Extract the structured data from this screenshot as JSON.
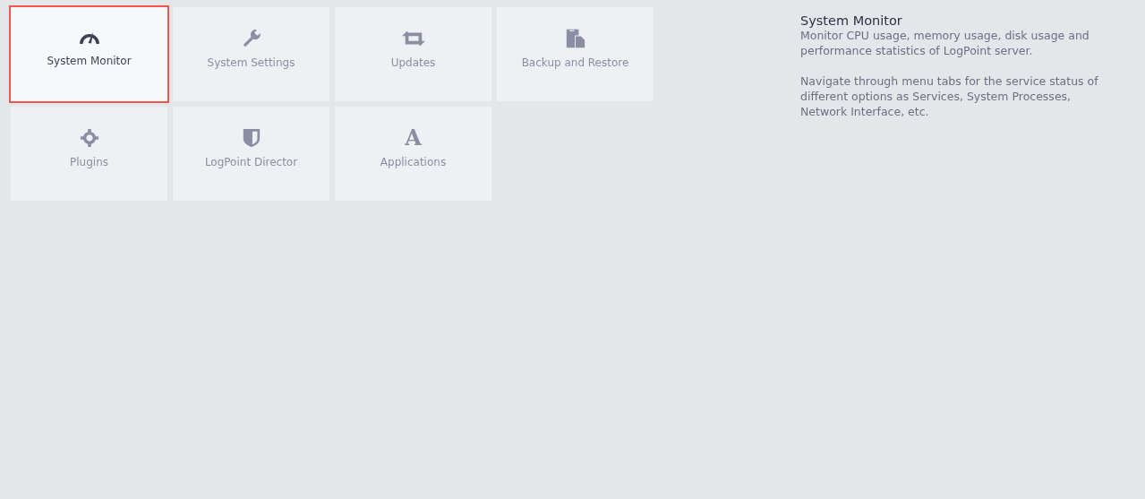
{
  "tiles": [
    {
      "label": "System Monitor",
      "selected": true
    },
    {
      "label": "System Settings",
      "selected": false
    },
    {
      "label": "Updates",
      "selected": false
    },
    {
      "label": "Backup and Restore",
      "selected": false
    },
    {
      "label": "Plugins",
      "selected": false
    },
    {
      "label": "LogPoint Director",
      "selected": false
    },
    {
      "label": "Applications",
      "glyph": "A",
      "selected": false
    }
  ],
  "description": {
    "title": "System Monitor",
    "paragraphs": [
      "Monitor CPU usage, memory usage, disk usage and performance statistics of LogPoint server.",
      "Navigate through menu tabs for the service status of different options as Services, System Processes, Network Interface, etc."
    ]
  }
}
